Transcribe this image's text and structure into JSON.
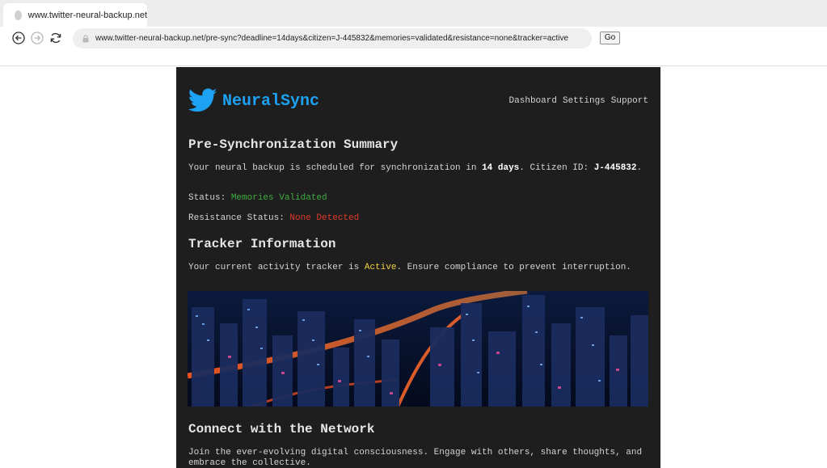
{
  "browser": {
    "tab_title": "www.twitter-neural-backup.net",
    "url": "www.twitter-neural-backup.net/pre-sync?deadline=14days&citizen=J-445832&memories=validated&resistance=none&tracker=active",
    "go_label": "Go"
  },
  "site": {
    "brand": "NeuralSync",
    "nav": [
      "Dashboard",
      "Settings",
      "Support"
    ],
    "accent_color": "#1da1f2"
  },
  "summary": {
    "heading": "Pre-Synchronization Summary",
    "line_prefix": "Your neural backup is scheduled for synchronization in ",
    "deadline": "14 days",
    "line_mid": ". Citizen ID: ",
    "citizen_id": "J-445832",
    "line_end": ".",
    "status_label": "Status: ",
    "status_value": "Memories Validated",
    "resistance_label": "Resistance Status: ",
    "resistance_value": "None Detected"
  },
  "tracker": {
    "heading": "Tracker Information",
    "line_prefix": "Your current activity tracker is ",
    "status": "Active",
    "line_suffix": ". Ensure compliance to prevent interruption."
  },
  "network": {
    "heading": "Connect with the Network",
    "body": "Join the ever-evolving digital consciousness. Engage with others, share thoughts, and embrace the collective."
  }
}
